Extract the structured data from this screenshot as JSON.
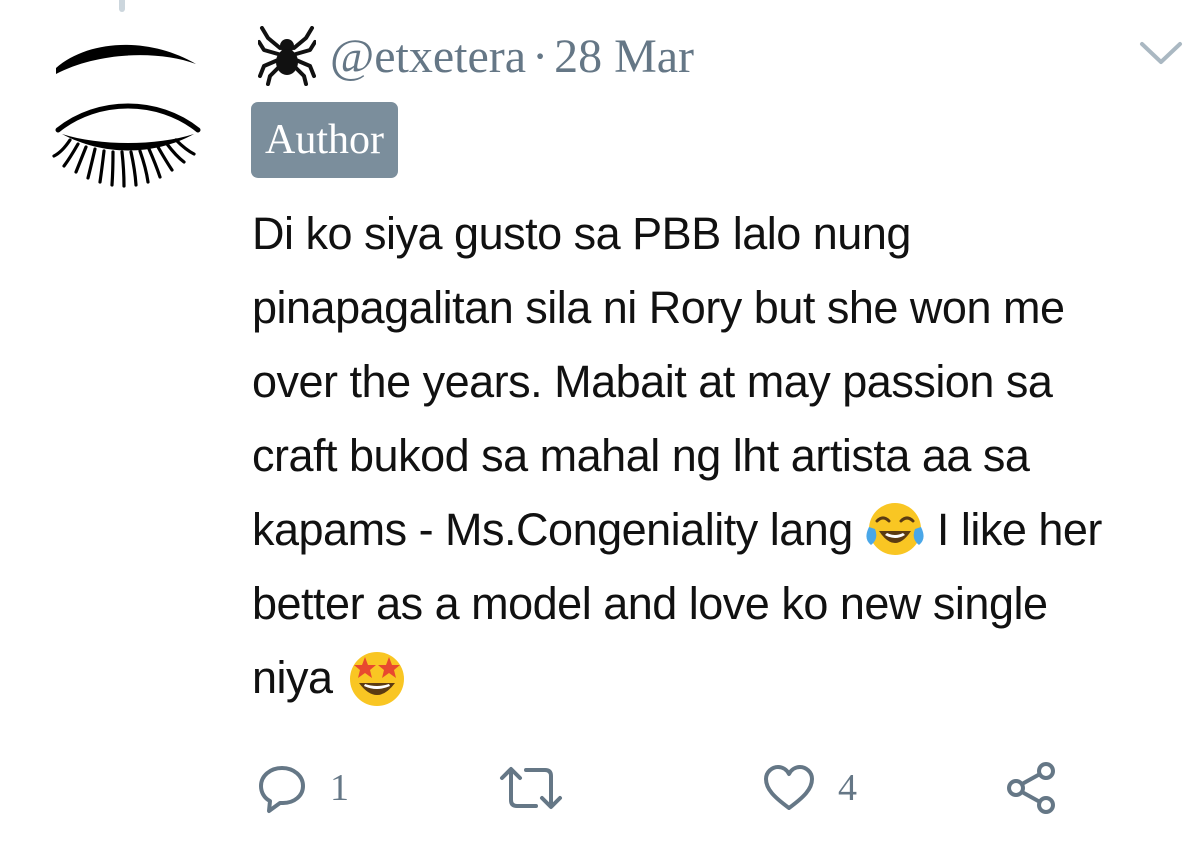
{
  "tweet": {
    "handle": "@etxetera",
    "separator": "·",
    "date": "28 Mar",
    "badge": "Author",
    "lines": {
      "l1": "Di ko siya gusto sa PBB lalo nung",
      "l2": "pinapagalitan sila ni Rory but she won me",
      "l3": "over the years. Mabait at may passion sa",
      "l4": "craft bukod sa mahal ng lht artista aa sa",
      "l5a": "kapams - Ms.Congeniality lang",
      "l5b": "I like her",
      "l6": "better as a model and love ko new single",
      "l7": "niya"
    },
    "emojis": [
      "face-with-tears-of-joy",
      "star-struck"
    ]
  },
  "actions": {
    "reply_count": "1",
    "like_count": "4"
  },
  "icons": {
    "avatar": "closed-eye-avatar",
    "spider": "spider-icon",
    "caret": "chevron-down-icon",
    "reply": "reply-icon",
    "retweet": "retweet-icon",
    "like": "heart-icon",
    "share": "share-icon"
  },
  "colors": {
    "muted": "#657786",
    "badge_bg": "#7b8e9c",
    "text": "#111111"
  }
}
